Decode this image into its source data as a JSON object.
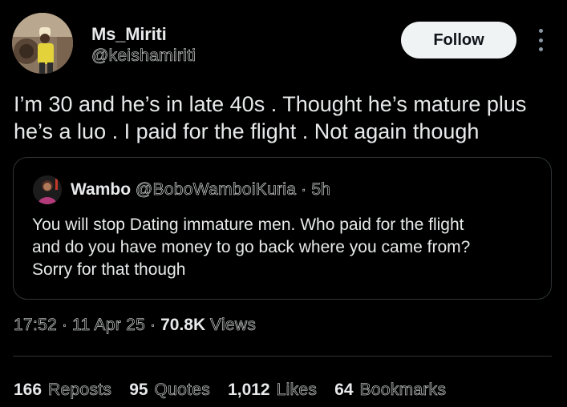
{
  "author": {
    "display_name": "Ms_Miriti",
    "handle": "@keishamiriti",
    "avatar_icon": "user-avatar-photo"
  },
  "follow_label": "Follow",
  "more_icon": "more-vertical-icon",
  "tweet": {
    "text": "I’m 30 and he’s in late 40s . Thought he’s mature plus\nhe’s a luo . I paid for the flight . Not again though"
  },
  "quote": {
    "name": "Wambo",
    "handle": "@BoboWamboiKuria",
    "separator": "·",
    "time": "5h",
    "text": "You will stop Dating immature men. Who paid for the flight\nand do you have money to go back where you came from?\nSorry for that though"
  },
  "meta": {
    "time": "17:52",
    "separator": "·",
    "date": "11 Apr 25",
    "views_count": "70.8K",
    "views_label": "Views"
  },
  "stats": [
    {
      "count": "166",
      "label": "Reposts"
    },
    {
      "count": "95",
      "label": "Quotes"
    },
    {
      "count": "1,012",
      "label": "Likes"
    },
    {
      "count": "64",
      "label": "Bookmarks"
    }
  ],
  "colors": {
    "background": "#000000",
    "text": "#e7e9ea",
    "secondary": "#8b98a5",
    "border": "#2f3336",
    "button_bg": "#eff3f4"
  }
}
